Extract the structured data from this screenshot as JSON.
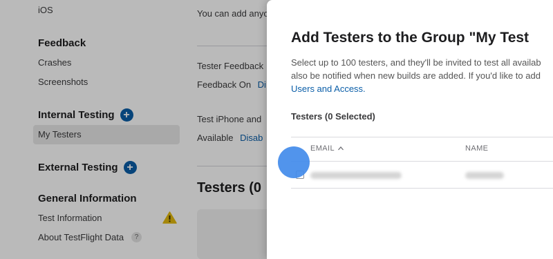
{
  "sidebar": {
    "ios": "iOS",
    "feedback_heading": "Feedback",
    "crashes": "Crashes",
    "screenshots": "Screenshots",
    "internal_testing": "Internal Testing",
    "my_testers": "My Testers",
    "external_testing": "External Testing",
    "general_information": "General Information",
    "test_information": "Test Information",
    "about": "About TestFlight Data",
    "help_glyph": "?"
  },
  "main": {
    "subtitle_fragment": "You can add anyo",
    "tester_feedback": "Tester Feedback",
    "feedback_on": "Feedback On",
    "feedback_link": "Di",
    "test_iphone": "Test iPhone and",
    "available": "Available",
    "disable_link": "Disab",
    "testers_title": "Testers (0"
  },
  "modal": {
    "title": "Add Testers to the Group \"My Test",
    "desc_line1": "Select up to 100 testers, and they'll be invited to test all availab",
    "desc_line2": "also be notified when new builds are added. If you'd like to add",
    "desc_link": "Users and Access.",
    "selected_count": "Testers (0 Selected)",
    "col_email": "EMAIL",
    "col_name": "NAME"
  },
  "colors": {
    "accent": "#0a5ea8",
    "warning": "#e3b90f",
    "cursor": "#428bea"
  }
}
